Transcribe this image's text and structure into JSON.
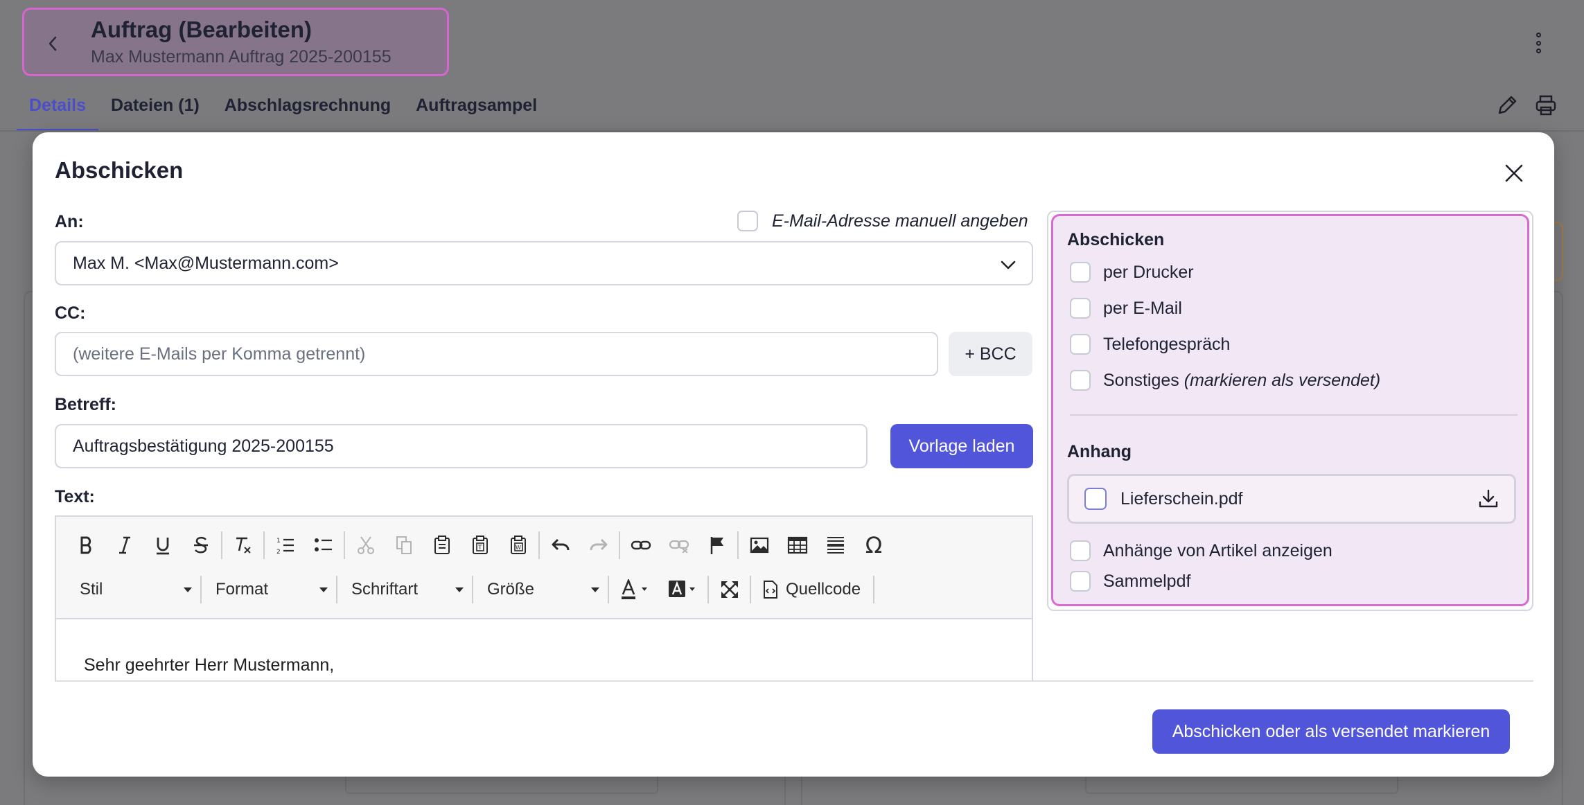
{
  "header": {
    "title": "Auftrag (Bearbeiten)",
    "subtitle": "Max Mustermann Auftrag 2025-200155"
  },
  "tabs": [
    {
      "label": "Details",
      "active": true
    },
    {
      "label": "Dateien (1)",
      "active": false
    },
    {
      "label": "Abschlagsrechnung",
      "active": false
    },
    {
      "label": "Auftragsampel",
      "active": false
    }
  ],
  "modal": {
    "title": "Abschicken",
    "to_label": "An:",
    "manual_email_label": "E-Mail-Adresse manuell angeben",
    "to_value": "Max M. <Max@Mustermann.com>",
    "cc_label": "CC:",
    "cc_placeholder": "(weitere E-Mails per Komma getrennt)",
    "bcc_button": "+ BCC",
    "subject_label": "Betreff:",
    "subject_value": "Auftragsbestätigung 2025-200155",
    "template_button": "Vorlage laden",
    "text_label": "Text:",
    "editor": {
      "style_combo": "Stil",
      "format_combo": "Format",
      "font_combo": "Schriftart",
      "size_combo": "Größe",
      "source_button": "Quellcode",
      "body_text": "Sehr geehrter Herr Mustermann,"
    },
    "send_section": {
      "title": "Abschicken",
      "options": [
        {
          "label": "per Drucker",
          "checked": false
        },
        {
          "label": "per E-Mail",
          "checked": false
        },
        {
          "label": "Telefongespräch",
          "checked": false
        },
        {
          "label": "Sonstiges",
          "note": "(markieren als versendet)",
          "checked": false
        }
      ]
    },
    "attachment_section": {
      "title": "Anhang",
      "file": "Lieferschein.pdf",
      "show_article_attachments": "Anhänge von Artikel anzeigen",
      "collect_pdf": "Sammelpdf"
    },
    "submit_button": "Abschicken oder als versendet markieren"
  },
  "colors": {
    "primary": "#5155d9",
    "highlight_border": "#d86ad2",
    "highlight_bg": "#f1e7f5",
    "overlay": "#7b7b7d"
  }
}
